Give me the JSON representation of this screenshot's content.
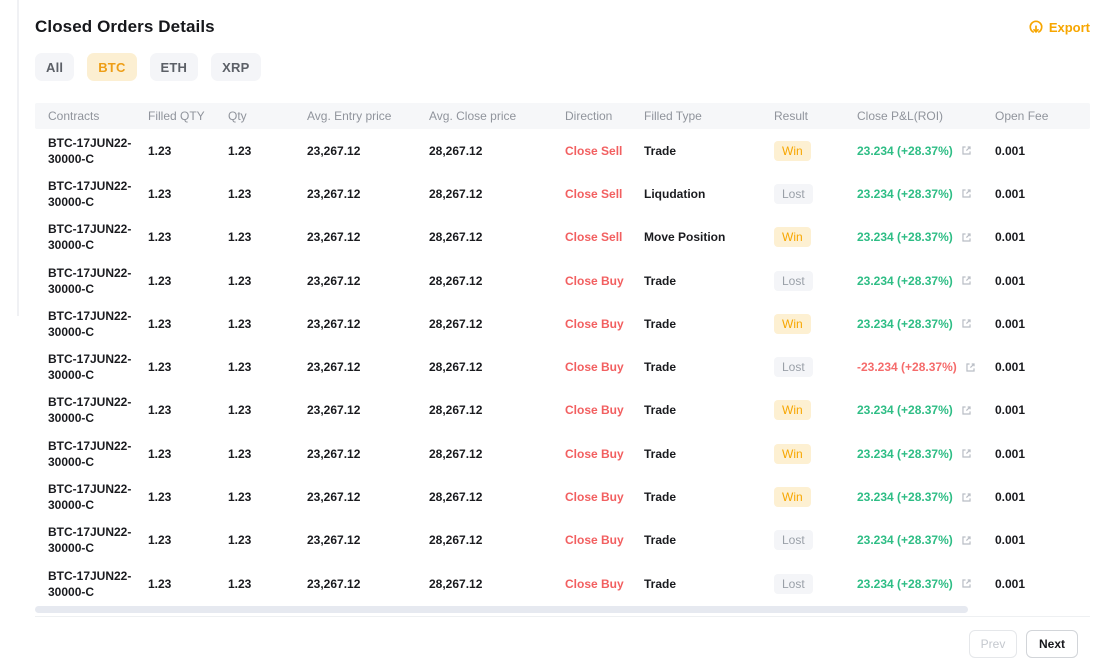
{
  "page": {
    "title": "Closed Orders Details"
  },
  "export": {
    "label": "Export",
    "icon": "download-circle-icon"
  },
  "filters": [
    {
      "label": "All",
      "active": false
    },
    {
      "label": "BTC",
      "active": true
    },
    {
      "label": "ETH",
      "active": false
    },
    {
      "label": "XRP",
      "active": false
    }
  ],
  "table": {
    "columns": [
      "Contracts",
      "Filled QTY",
      "Qty",
      "Avg. Entry price",
      "Avg. Close price",
      "Direction",
      "Filled Type",
      "Result",
      "Close P&L(ROI)",
      "Open Fee"
    ],
    "pnl_link_icon": "external-link-icon",
    "rows": [
      {
        "contract": "BTC-17JUN22-30000-C",
        "filled_qty": "1.23",
        "qty": "1.23",
        "avg_entry_price": "23,267.12",
        "avg_close_price": "28,267.12",
        "direction": "Close Sell",
        "filled_type": "Trade",
        "result": "Win",
        "pnl": "23.234 (+28.37%)",
        "pnl_negative": false,
        "open_fee": "0.001"
      },
      {
        "contract": "BTC-17JUN22-30000-C",
        "filled_qty": "1.23",
        "qty": "1.23",
        "avg_entry_price": "23,267.12",
        "avg_close_price": "28,267.12",
        "direction": "Close Sell",
        "filled_type": "Liqudation",
        "result": "Lost",
        "pnl": "23.234 (+28.37%)",
        "pnl_negative": false,
        "open_fee": "0.001"
      },
      {
        "contract": "BTC-17JUN22-30000-C",
        "filled_qty": "1.23",
        "qty": "1.23",
        "avg_entry_price": "23,267.12",
        "avg_close_price": "28,267.12",
        "direction": "Close Sell",
        "filled_type": "Move Position",
        "result": "Win",
        "pnl": "23.234 (+28.37%)",
        "pnl_negative": false,
        "open_fee": "0.001"
      },
      {
        "contract": "BTC-17JUN22-30000-C",
        "filled_qty": "1.23",
        "qty": "1.23",
        "avg_entry_price": "23,267.12",
        "avg_close_price": "28,267.12",
        "direction": "Close Buy",
        "filled_type": "Trade",
        "result": "Lost",
        "pnl": "23.234 (+28.37%)",
        "pnl_negative": false,
        "open_fee": "0.001"
      },
      {
        "contract": "BTC-17JUN22-30000-C",
        "filled_qty": "1.23",
        "qty": "1.23",
        "avg_entry_price": "23,267.12",
        "avg_close_price": "28,267.12",
        "direction": "Close Buy",
        "filled_type": "Trade",
        "result": "Win",
        "pnl": "23.234 (+28.37%)",
        "pnl_negative": false,
        "open_fee": "0.001"
      },
      {
        "contract": "BTC-17JUN22-30000-C",
        "filled_qty": "1.23",
        "qty": "1.23",
        "avg_entry_price": "23,267.12",
        "avg_close_price": "28,267.12",
        "direction": "Close Buy",
        "filled_type": "Trade",
        "result": "Lost",
        "pnl": "-23.234 (+28.37%)",
        "pnl_negative": true,
        "open_fee": "0.001"
      },
      {
        "contract": "BTC-17JUN22-30000-C",
        "filled_qty": "1.23",
        "qty": "1.23",
        "avg_entry_price": "23,267.12",
        "avg_close_price": "28,267.12",
        "direction": "Close Buy",
        "filled_type": "Trade",
        "result": "Win",
        "pnl": "23.234 (+28.37%)",
        "pnl_negative": false,
        "open_fee": "0.001"
      },
      {
        "contract": "BTC-17JUN22-30000-C",
        "filled_qty": "1.23",
        "qty": "1.23",
        "avg_entry_price": "23,267.12",
        "avg_close_price": "28,267.12",
        "direction": "Close Buy",
        "filled_type": "Trade",
        "result": "Win",
        "pnl": "23.234 (+28.37%)",
        "pnl_negative": false,
        "open_fee": "0.001"
      },
      {
        "contract": "BTC-17JUN22-30000-C",
        "filled_qty": "1.23",
        "qty": "1.23",
        "avg_entry_price": "23,267.12",
        "avg_close_price": "28,267.12",
        "direction": "Close Buy",
        "filled_type": "Trade",
        "result": "Win",
        "pnl": "23.234 (+28.37%)",
        "pnl_negative": false,
        "open_fee": "0.001"
      },
      {
        "contract": "BTC-17JUN22-30000-C",
        "filled_qty": "1.23",
        "qty": "1.23",
        "avg_entry_price": "23,267.12",
        "avg_close_price": "28,267.12",
        "direction": "Close Buy",
        "filled_type": "Trade",
        "result": "Lost",
        "pnl": "23.234 (+28.37%)",
        "pnl_negative": false,
        "open_fee": "0.001"
      },
      {
        "contract": "BTC-17JUN22-30000-C",
        "filled_qty": "1.23",
        "qty": "1.23",
        "avg_entry_price": "23,267.12",
        "avg_close_price": "28,267.12",
        "direction": "Close Buy",
        "filled_type": "Trade",
        "result": "Lost",
        "pnl": "23.234 (+28.37%)",
        "pnl_negative": false,
        "open_fee": "0.001"
      }
    ]
  },
  "pagination": {
    "prev": "Prev",
    "next": "Next"
  },
  "colors": {
    "accent_orange": "#f7a600",
    "positive_green": "#2ebd85",
    "negative_red": "#f56b6b",
    "direction_red": "#f25f60",
    "win_badge_bg": "#fdf0d2",
    "lost_badge_bg": "#f4f5f8",
    "header_bg": "#f6f7f9"
  }
}
